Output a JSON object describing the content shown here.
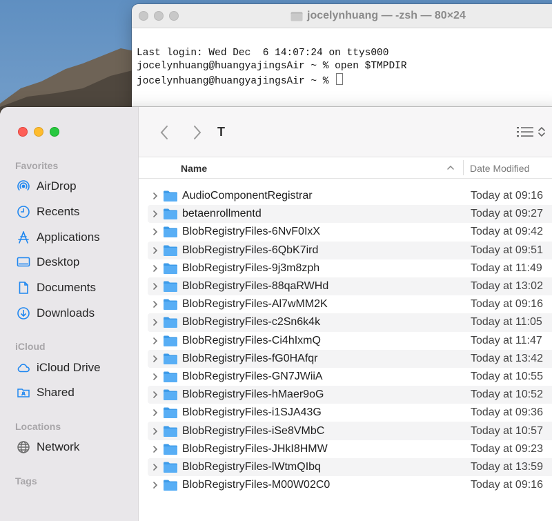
{
  "colors": {
    "accent": "#1f87f0",
    "folder": "#58aef5",
    "sidebar_bg": "#e9e7ea"
  },
  "terminal": {
    "title": "jocelynhuang — -zsh — 80×24",
    "lines": [
      "Last login: Wed Dec  6 14:07:24 on ttys000",
      "jocelynhuang@huangyajingsAir ~ % open $TMPDIR",
      "jocelynhuang@huangyajingsAir ~ % "
    ]
  },
  "finder": {
    "path_title": "T",
    "sidebar": {
      "favorites_title": "Favorites",
      "favorites": [
        {
          "label": "AirDrop",
          "icon": "airdrop-icon"
        },
        {
          "label": "Recents",
          "icon": "clock-icon"
        },
        {
          "label": "Applications",
          "icon": "applications-icon"
        },
        {
          "label": "Desktop",
          "icon": "desktop-icon"
        },
        {
          "label": "Documents",
          "icon": "document-icon"
        },
        {
          "label": "Downloads",
          "icon": "download-icon"
        }
      ],
      "icloud_title": "iCloud",
      "icloud": [
        {
          "label": "iCloud Drive",
          "icon": "cloud-icon"
        },
        {
          "label": "Shared",
          "icon": "shared-folder-icon"
        }
      ],
      "locations_title": "Locations",
      "locations": [
        {
          "label": "Network",
          "icon": "globe-icon"
        }
      ],
      "tags_title": "Tags"
    },
    "columns": {
      "name": "Name",
      "date_modified": "Date Modified"
    },
    "files": [
      {
        "name": "AudioComponentRegistrar",
        "date": "Today at 09:16"
      },
      {
        "name": "betaenrollmentd",
        "date": "Today at 09:27"
      },
      {
        "name": "BlobRegistryFiles-6NvF0IxX",
        "date": "Today at 09:42"
      },
      {
        "name": "BlobRegistryFiles-6QbK7ird",
        "date": "Today at 09:51"
      },
      {
        "name": "BlobRegistryFiles-9j3m8zph",
        "date": "Today at 11:49"
      },
      {
        "name": "BlobRegistryFiles-88qaRWHd",
        "date": "Today at 13:02"
      },
      {
        "name": "BlobRegistryFiles-Al7wMM2K",
        "date": "Today at 09:16"
      },
      {
        "name": "BlobRegistryFiles-c2Sn6k4k",
        "date": "Today at 11:05"
      },
      {
        "name": "BlobRegistryFiles-Ci4hIxmQ",
        "date": "Today at 11:47"
      },
      {
        "name": "BlobRegistryFiles-fG0HAfqr",
        "date": "Today at 13:42"
      },
      {
        "name": "BlobRegistryFiles-GN7JWiiA",
        "date": "Today at 10:55"
      },
      {
        "name": "BlobRegistryFiles-hMaer9oG",
        "date": "Today at 10:52"
      },
      {
        "name": "BlobRegistryFiles-i1SJA43G",
        "date": "Today at 09:36"
      },
      {
        "name": "BlobRegistryFiles-iSe8VMbC",
        "date": "Today at 10:57"
      },
      {
        "name": "BlobRegistryFiles-JHkI8HMW",
        "date": "Today at 09:23"
      },
      {
        "name": "BlobRegistryFiles-lWtmQIbq",
        "date": "Today at 13:59"
      },
      {
        "name": "BlobRegistryFiles-M00W02C0",
        "date": "Today at 09:16"
      }
    ]
  }
}
